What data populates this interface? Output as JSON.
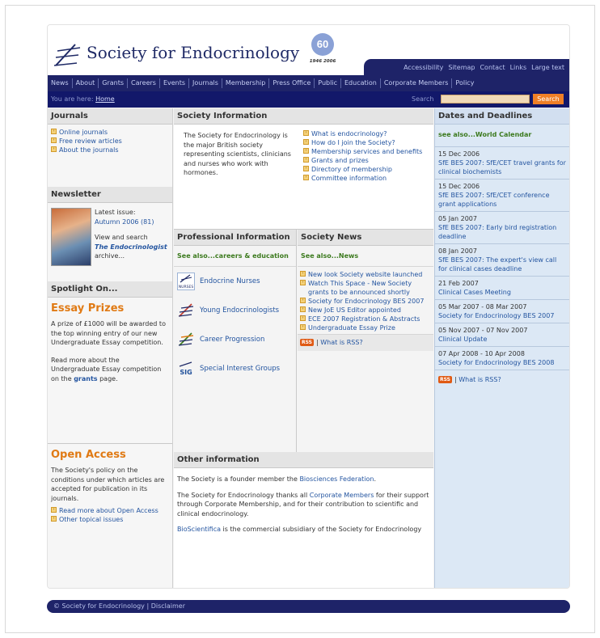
{
  "site": {
    "title": "Society for Endocrinology",
    "anniversary": {
      "number": "60",
      "years": "1946 2006"
    }
  },
  "utility_links": [
    "Accessibility",
    "Sitemap",
    "Contact",
    "Links",
    "Large text"
  ],
  "nav": [
    "News",
    "About",
    "Grants",
    "Careers",
    "Events",
    "Journals",
    "Membership",
    "Press Office",
    "Public",
    "Education",
    "Corporate Members",
    "Policy"
  ],
  "breadcrumb": {
    "prefix": "You are here:",
    "home": "Home"
  },
  "search": {
    "label": "Search",
    "placeholder": "",
    "button": "Search"
  },
  "journals": {
    "heading": "Journals",
    "items": [
      "Online journals",
      "Free review articles",
      "About the journals"
    ]
  },
  "newsletter": {
    "heading": "Newsletter",
    "latest_label": "Latest issue:",
    "latest_link": "Autumn 2006 (81)",
    "view_text": "View and search",
    "archive_link": "The Endocrinologist",
    "archive_suffix": "archive..."
  },
  "spotlight": {
    "heading": "Spotlight On...",
    "title": "Essay Prizes",
    "text1": "A prize of £1000 will be awarded to the top winning entry of our new Undergraduate Essay competition.",
    "text2_pre": "Read more about the Undergraduate Essay competition on the",
    "text2_link": "grants",
    "text2_post": "page."
  },
  "open_access": {
    "title": "Open Access",
    "text": "The Society's policy on the conditions under which articles are accepted for publication in its journals.",
    "items": [
      "Read more about Open Access",
      "Other topical issues"
    ]
  },
  "society_info": {
    "heading": "Society Information",
    "text": "The Society for Endocrinology is the major British society representing scientists, clinicians and nurses who work with hormones.",
    "items": [
      "What is endocrinology?",
      "How do I join the Society?",
      "Membership services and benefits",
      "Grants and prizes",
      "Directory of membership",
      "Committee information"
    ]
  },
  "professional": {
    "heading": "Professional Information",
    "see_also_prefix": "See also...",
    "see_also_link": "careers & education",
    "items": [
      {
        "label": "Endocrine Nurses",
        "icon": "nurses-icon",
        "icon_text": "NURSES"
      },
      {
        "label": "Young Endocrinologists",
        "icon": "young-endo-icon",
        "icon_text": ""
      },
      {
        "label": "Career Progression",
        "icon": "career-icon",
        "icon_text": ""
      },
      {
        "label": "Special Interest Groups",
        "icon": "sig-icon",
        "icon_text": "SIG"
      }
    ]
  },
  "society_news": {
    "heading": "Society News",
    "see_also_prefix": "See also...",
    "see_also_link": "News",
    "items": [
      "New look Society website launched",
      "Watch This Space - New Society grants to be announced shortly",
      "Society for Endocrinology BES 2007",
      "New JoE US Editor appointed",
      "ECE 2007 Registration & Abstracts",
      "Undergraduate Essay Prize"
    ],
    "rss_badge": "RSS",
    "rss_link": "What is RSS?"
  },
  "other_info": {
    "heading": "Other information",
    "p1_pre": "The Society is a founder member the",
    "p1_link": "Biosciences Federation",
    "p1_post": ".",
    "p2_pre": "The Society for Endocrinology thanks all",
    "p2_link": "Corporate Members",
    "p2_post": "for their support through Corporate Membership, and for their contribution to scientific and clinical endocrinology.",
    "p3_link": "BioScientifica",
    "p3_post": "is the commercial subsidiary of the Society for Endocrinology"
  },
  "dates": {
    "heading": "Dates and Deadlines",
    "see_also_prefix": "see also...",
    "see_also_link": "World Calendar",
    "items": [
      {
        "date": "15 Dec 2006",
        "title": "SfE BES 2007: SfE/CET travel grants for clinical biochemists"
      },
      {
        "date": "15 Dec 2006",
        "title": "SfE BES 2007: SfE/CET conference grant applications"
      },
      {
        "date": "05 Jan 2007",
        "title": "SfE BES 2007: Early bird registration deadline"
      },
      {
        "date": "08 Jan 2007",
        "title": "SfE BES 2007: The expert's view call for clinical cases deadline"
      },
      {
        "date": "21 Feb 2007",
        "title": "Clinical Cases Meeting"
      },
      {
        "date": "05 Mar 2007 - 08 Mar 2007",
        "title": "Society for Endocrinology BES 2007"
      },
      {
        "date": "05 Nov 2007 - 07 Nov 2007",
        "title": "Clinical Update"
      },
      {
        "date": "07 Apr 2008 - 10 Apr 2008",
        "title": "Society for Endocrinology BES 2008"
      }
    ],
    "rss_badge": "RSS",
    "rss_link": "What is RSS?"
  },
  "footer": {
    "text": "© Society for Endocrinology | Disclaimer"
  },
  "colors": {
    "navy": "#1e2368",
    "orange": "#e07a14",
    "link": "#2455a0",
    "dates_bg": "#dce8f5"
  }
}
